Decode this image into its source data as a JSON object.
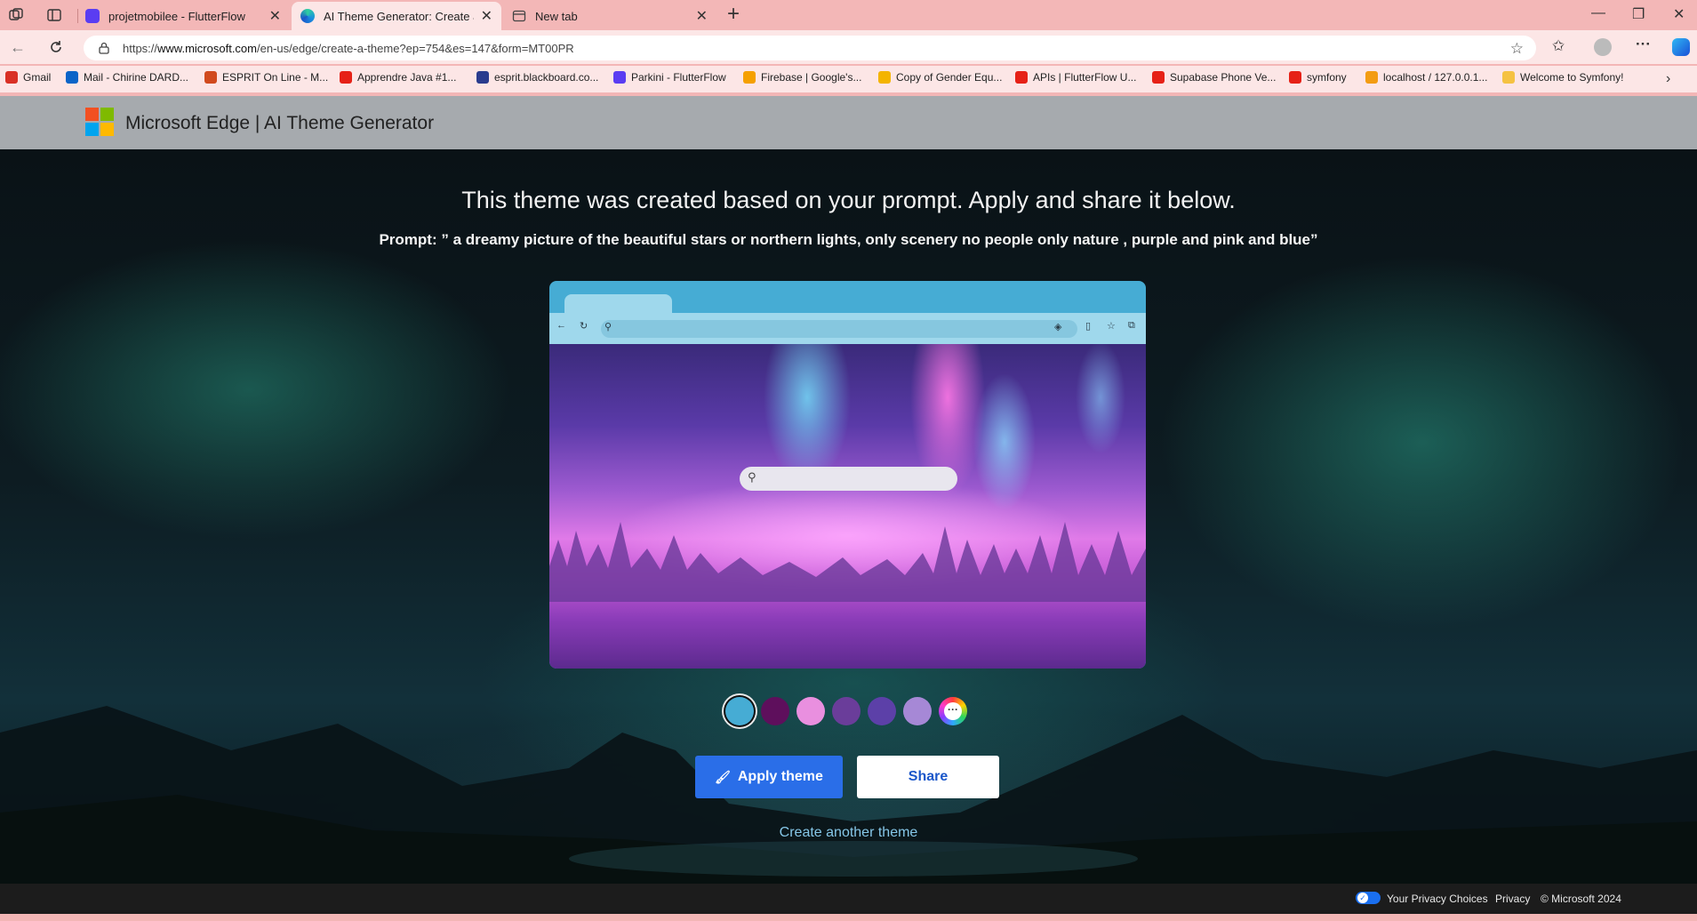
{
  "browser": {
    "tabs": [
      {
        "label": "projetmobilee - FlutterFlow",
        "favicon_color": "#5a3df2"
      },
      {
        "label": "AI Theme Generator: Create a Cus",
        "favicon_color": "#2a8ec9"
      },
      {
        "label": "New tab",
        "favicon_color": "#444444"
      }
    ],
    "address": {
      "url_prefix": "https://",
      "url_host": "www.microsoft.com",
      "url_path": "/en-us/edge/create-a-theme?ep=754&es=147&form=MT00PR"
    },
    "bookmarks": [
      {
        "label": "Gmail",
        "icon": "gmail-icon",
        "color": "#d93025"
      },
      {
        "label": "Mail - Chirine DARD...",
        "icon": "outlook-icon",
        "color": "#0a64c8"
      },
      {
        "label": "ESPRIT On Line - M...",
        "icon": "esprit-icon",
        "color": "#d14a1e"
      },
      {
        "label": "Apprendre Java #1...",
        "icon": "youtube-icon",
        "color": "#e62117"
      },
      {
        "label": "esprit.blackboard.co...",
        "icon": "blackboard-icon",
        "color": "#2a3c8e"
      },
      {
        "label": "Parkini - FlutterFlow",
        "icon": "flutterflow-icon",
        "color": "#5a3df2"
      },
      {
        "label": "Firebase | Google's...",
        "icon": "firebase-icon",
        "color": "#f5a000"
      },
      {
        "label": "Copy of Gender Equ...",
        "icon": "slides-icon",
        "color": "#f4b400"
      },
      {
        "label": "APIs | FlutterFlow U...",
        "icon": "youtube-icon",
        "color": "#e62117"
      },
      {
        "label": "Supabase Phone Ve...",
        "icon": "youtube-icon",
        "color": "#e62117"
      },
      {
        "label": "symfony",
        "icon": "youtube-icon",
        "color": "#e62117"
      },
      {
        "label": "localhost / 127.0.0.1...",
        "icon": "phpmyadmin-icon",
        "color": "#f39c12"
      },
      {
        "label": "Welcome to Symfony!",
        "icon": "symfony-icon",
        "color": "#f5c242"
      }
    ]
  },
  "site": {
    "title": "Microsoft Edge | AI Theme Generator",
    "logo_colors": [
      "#f25022",
      "#7fba00",
      "#00a4ef",
      "#ffb900"
    ]
  },
  "hero": {
    "title": "This theme was created based on your prompt. Apply and share it below.",
    "prompt": "Prompt: ” a dreamy picture of the beautiful stars or northern lights, only scenery no people only nature , purple and pink and blue”"
  },
  "swatches": [
    {
      "color": "#46acd4",
      "selected": true
    },
    {
      "color": "#5e0f5c",
      "selected": false
    },
    {
      "color": "#e98fdf",
      "selected": false
    },
    {
      "color": "#6a3d9a",
      "selected": false
    },
    {
      "color": "#5c40a8",
      "selected": false
    },
    {
      "color": "#a688d6",
      "selected": false
    }
  ],
  "actions": {
    "apply_label": "Apply theme",
    "share_label": "Share",
    "create_another_label": "Create another theme"
  },
  "footer": {
    "privacy_choices": "Your Privacy Choices",
    "privacy": "Privacy",
    "copyright": "© Microsoft 2024"
  }
}
